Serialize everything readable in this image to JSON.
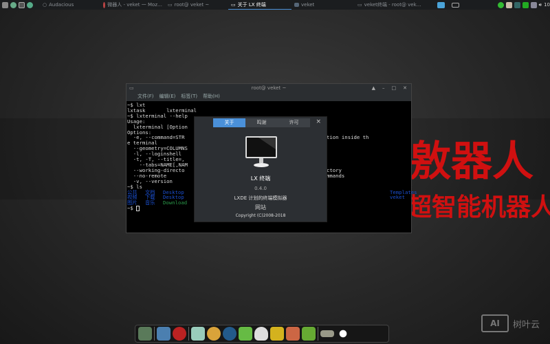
{
  "taskbar": {
    "items": [
      {
        "label": "Audacious"
      },
      {
        "label": "微器人 - veket 一 Moz…"
      },
      {
        "label": "root@ veket ~"
      },
      {
        "label": "关于 LX 终端"
      },
      {
        "label": "veket"
      },
      {
        "label": "veket终端 - root@ vek…"
      }
    ],
    "clock": "10"
  },
  "background": {
    "line1": "敫器人",
    "line2": "超智能机器人"
  },
  "terminal": {
    "title": "root@ veket ~",
    "menu": [
      "文件(F)",
      "编辑(E)",
      "标签(T)",
      "帮助(H)"
    ],
    "lines": [
      "~$ lxt",
      "lxtask       lxterminal",
      "~$ lxterminal --help",
      "Usage:",
      "  lxterminal [Option                                         ator",
      "",
      "Options:",
      "  -e, --command=STR                                      o this option inside th",
      "e terminal",
      "  --geometry=COLUMNS                                     e",
      "  -l, --loginshell",
      "  -t, -T, --title=,",
      "    --tabs=NAME[,NAM                                     le",
      "  --working-directo                                      king directory",
      "  --no-remote                                            remote commands",
      "  -v, --version",
      "",
      "~$ ls"
    ],
    "ls_rows": [
      [
        "公共",
        "文档",
        "Desktop",
        "Templates"
      ],
      [
        "视频",
        "下载",
        "Desktop",
        "veket"
      ],
      [
        "图片",
        "音乐",
        "Download",
        ""
      ]
    ],
    "prompt": "~$ "
  },
  "about_dialog": {
    "tabs": [
      "关于",
      "鸣谢",
      "许可"
    ],
    "close": "×",
    "app_name": "LX 终端",
    "version": "0.4.0",
    "description": "LXDE 计划的终端模拟器",
    "website": "网站",
    "copyright": "Copyright (C)2008-2018"
  },
  "watermark": {
    "logo": "AI",
    "text": "树叶云"
  }
}
